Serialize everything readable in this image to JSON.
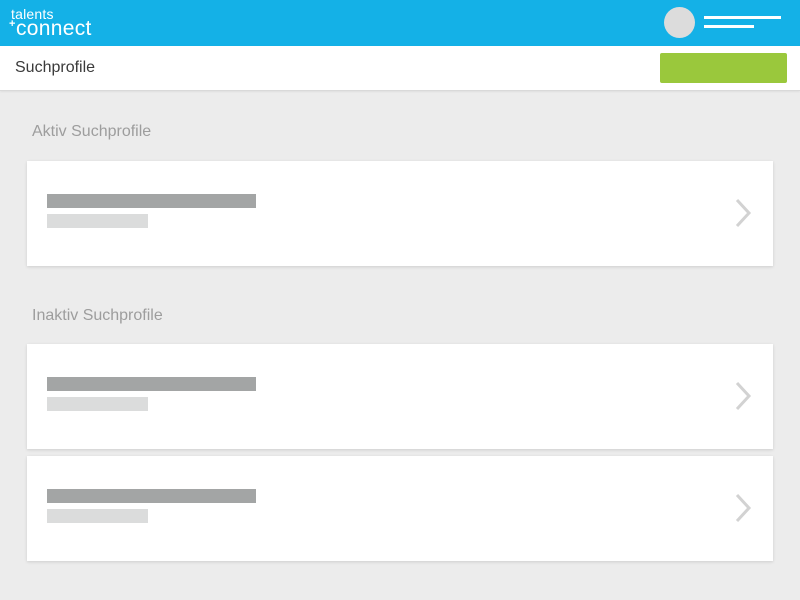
{
  "app": {
    "logo_top": "talents",
    "logo_plus": "+",
    "logo_bottom": "connect",
    "brand_color": "#14b1e7",
    "accent_color": "#9ac83c"
  },
  "header": {
    "title": "Suchprofile",
    "primary_button_label": ""
  },
  "sections": {
    "active": {
      "heading": "Aktiv Suchprofile",
      "items": [
        {
          "title": "",
          "subtitle": ""
        }
      ]
    },
    "inactive": {
      "heading": "Inaktiv Suchprofile",
      "items": [
        {
          "title": "",
          "subtitle": ""
        },
        {
          "title": "",
          "subtitle": ""
        }
      ]
    }
  },
  "icons": {
    "chevron": "chevron-right-icon",
    "avatar": "avatar",
    "menu": "user-menu-lines"
  }
}
